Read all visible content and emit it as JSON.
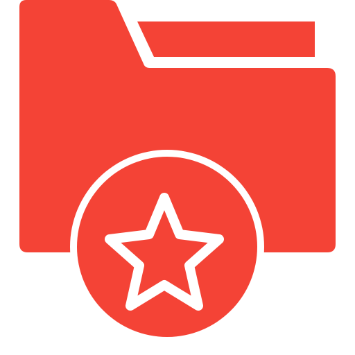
{
  "icon": {
    "name": "favorite-folder-icon",
    "accent_color": "#F44336",
    "inner_line_color": "#FFFFFF",
    "background_color": "#FFFFFF"
  }
}
